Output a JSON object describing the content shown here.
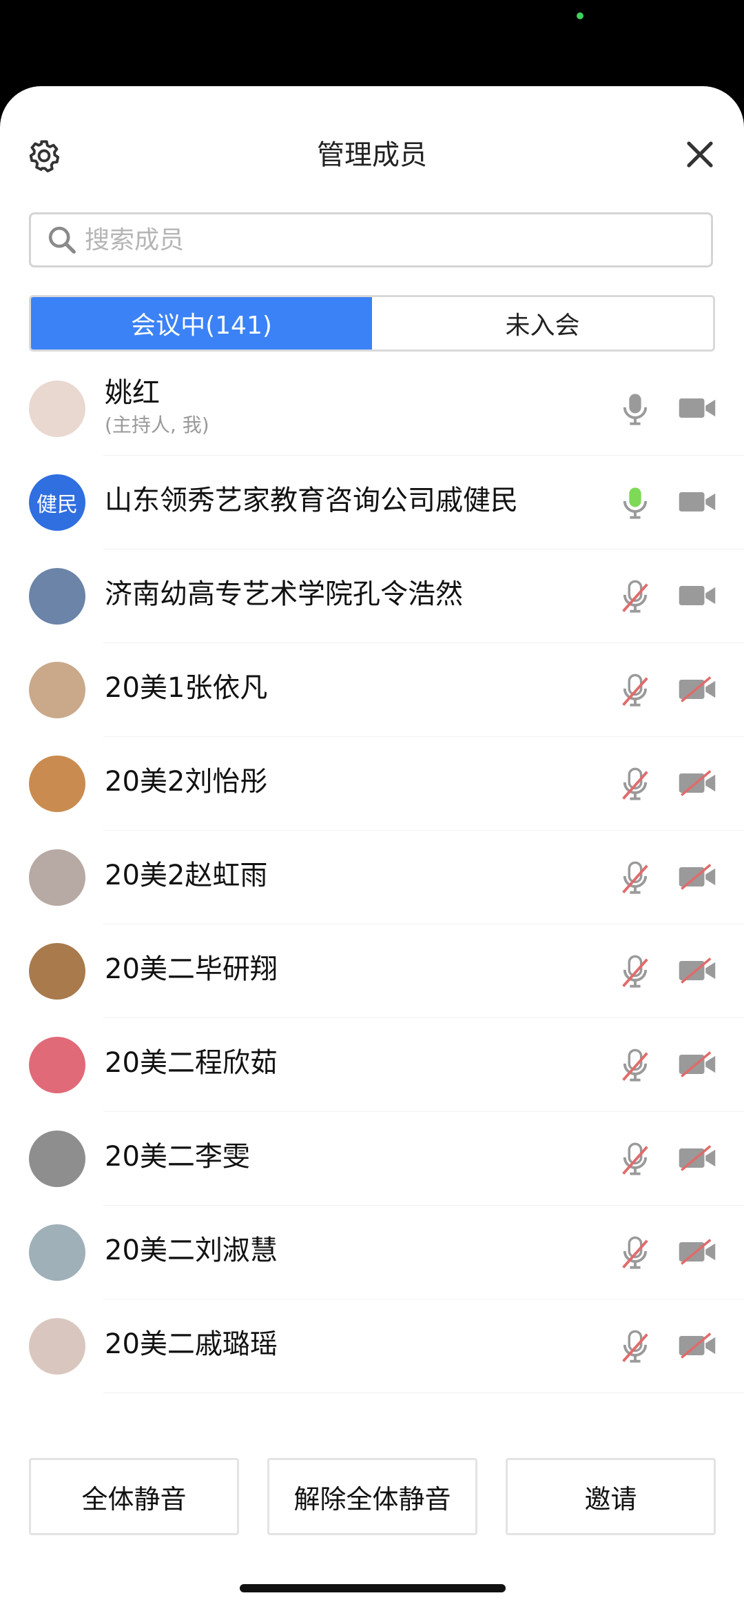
{
  "header": {
    "title": "管理成员",
    "settings_icon": "gear-icon",
    "close_icon": "close-icon"
  },
  "search": {
    "placeholder": "搜索成员",
    "value": ""
  },
  "tabs": [
    {
      "label": "会议中(141)",
      "active": true
    },
    {
      "label": "未入会",
      "active": false
    }
  ],
  "members": [
    {
      "name": "姚红",
      "role": "(主持人, 我)",
      "mic": "on",
      "camera": "on",
      "avatar_color": "#e9d8d0"
    },
    {
      "name": "山东领秀艺家教育咨询公司戚健民",
      "avatar_text": "健民",
      "mic": "speaking",
      "camera": "on",
      "avatar_color": "#2f6fe0"
    },
    {
      "name": "济南幼高专艺术学院孔令浩然",
      "mic": "muted",
      "camera": "on",
      "avatar_color": "#6b84a8"
    },
    {
      "name": "20美1张依凡",
      "mic": "muted",
      "camera": "off",
      "avatar_color": "#c9a98a"
    },
    {
      "name": "20美2刘怡彤",
      "mic": "muted",
      "camera": "off",
      "avatar_color": "#c98b4f"
    },
    {
      "name": "20美2赵虹雨",
      "mic": "muted",
      "camera": "off",
      "avatar_color": "#b7a9a3"
    },
    {
      "name": "20美二毕研翔",
      "mic": "muted",
      "camera": "off",
      "avatar_color": "#a87a4c"
    },
    {
      "name": "20美二程欣茹",
      "mic": "muted",
      "camera": "off",
      "avatar_color": "#e06a78"
    },
    {
      "name": "20美二李雯",
      "mic": "muted",
      "camera": "off",
      "avatar_color": "#8e8e8e"
    },
    {
      "name": "20美二刘淑慧",
      "mic": "muted",
      "camera": "off",
      "avatar_color": "#9fb0b8"
    },
    {
      "name": "20美二戚璐瑶",
      "mic": "muted",
      "camera": "off",
      "avatar_color": "#d9c7bf"
    }
  ],
  "footer": {
    "mute_all": "全体静音",
    "unmute_all": "解除全体静音",
    "invite": "邀请"
  },
  "colors": {
    "accent": "#3b82f6",
    "speaking": "#7ed957",
    "muted_slash": "#e06b6b",
    "icon_gray": "#9a9a9a"
  }
}
